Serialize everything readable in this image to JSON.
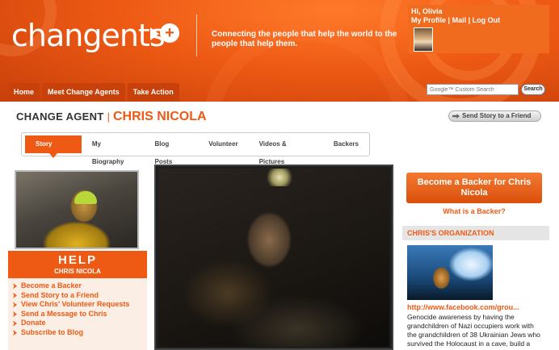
{
  "header": {
    "logo_text": "changents",
    "tagline": "Connecting the people that help the world to the people that help them.",
    "user": {
      "greeting": "Hi, Olivia",
      "links": [
        "My Profile",
        "Mail",
        "Log Out"
      ],
      "separator": "|"
    },
    "nav_tabs": [
      "Home",
      "Meet Change Agents",
      "Take Action"
    ],
    "search": {
      "placeholder": "Google™ Custom Search",
      "button_label": "Search"
    }
  },
  "agent": {
    "prefix": "CHANGE AGENT",
    "separator": "|",
    "name": "CHRIS NICOLA",
    "send_story_label": "Send Story to a Friend"
  },
  "subnav": {
    "tabs": [
      "Story Home",
      "My Biography",
      "Blog Posts",
      "Volunteer",
      "Videos & Pictures",
      "Backers"
    ],
    "active_index": 0
  },
  "help": {
    "title": "HELP",
    "subtitle": "CHRIS NICOLA",
    "items": [
      "Become a Backer",
      "Send Story to a Friend",
      "View Chris' Volunteer Requests",
      "Send a Message to Chris",
      "Donate",
      "Subscribe to Blog"
    ]
  },
  "right": {
    "backer_button": "Become a Backer for Chris Nicola",
    "what_is_backer": "What is a Backer?",
    "org_heading": "CHRIS'S ORGANIZATION",
    "org_link": "http://www.facebook.com/grou...",
    "org_description": "Genocide awareness by having the grandchildren of Nazi occupiers work with the grandchildren of 38 Ukrainian Jews who survived the Holocaust in a cave, build a museum exhibit together"
  },
  "colors": {
    "brand_orange": "#ee5a14",
    "dark_orange": "#c8400a",
    "help_bg": "#fbeee4"
  }
}
